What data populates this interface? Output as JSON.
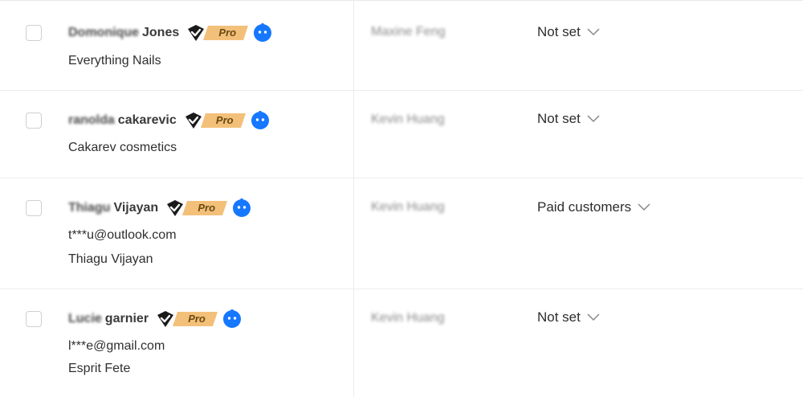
{
  "rows": [
    {
      "name_blurred": "Domonique",
      "name_rest": "Jones",
      "pro_label": "Pro",
      "lines": [
        "Everything Nails"
      ],
      "owner": "Maxine Feng",
      "segment": "Not set"
    },
    {
      "name_blurred": "ranolda",
      "name_rest": "cakarevic",
      "pro_label": "Pro",
      "lines": [
        "Cakarev cosmetics"
      ],
      "owner": "Kevin Huang",
      "segment": "Not set"
    },
    {
      "name_blurred": "Thiagu",
      "name_rest": "Vijayan",
      "pro_label": "Pro",
      "lines": [
        "t***u@outlook.com",
        "Thiagu Vijayan"
      ],
      "owner": "Kevin Huang",
      "segment": "Paid customers"
    },
    {
      "name_blurred": "Lucie",
      "name_rest": "garnier",
      "pro_label": "Pro",
      "lines": [
        "l***e@gmail.com",
        "Esprit Fete"
      ],
      "owner": "Kevin Huang",
      "segment": "Not set"
    }
  ],
  "icons": {
    "verified": "verified-check-shield-icon",
    "bot": "chat-bot-icon",
    "chevron": "chevron-down-icon"
  },
  "colors": {
    "bot_blue": "#1677ff",
    "pro_gold": "#f3c07a",
    "divider": "#ececec"
  }
}
